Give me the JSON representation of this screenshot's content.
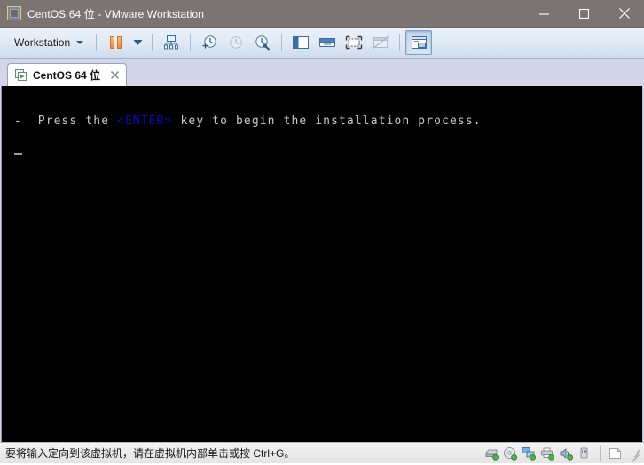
{
  "window": {
    "title": "CentOS 64 位 - VMware Workstation",
    "icon": "vmware-vm-icon",
    "controls": {
      "minimize": "minimize-icon",
      "maximize": "maximize-icon",
      "close": "close-icon"
    }
  },
  "toolbar": {
    "menu_label": "Workstation",
    "items": [
      {
        "name": "pause-vm-button",
        "icon": "pause-icon",
        "disabled": false
      },
      {
        "name": "power-dropdown-button",
        "icon": "chevron-down-icon",
        "disabled": false
      },
      {
        "name": "manage-vm-settings-button",
        "icon": "vm-settings-icon",
        "disabled": false
      },
      {
        "name": "take-snapshot-button",
        "icon": "snapshot-add-icon",
        "disabled": false
      },
      {
        "name": "revert-snapshot-button",
        "icon": "snapshot-revert-icon",
        "disabled": true
      },
      {
        "name": "snapshot-manager-button",
        "icon": "snapshot-manager-icon",
        "disabled": false
      },
      {
        "name": "show-library-button",
        "icon": "library-panel-icon",
        "disabled": false
      },
      {
        "name": "show-console-view-button",
        "icon": "console-view-icon",
        "disabled": false
      },
      {
        "name": "enter-full-screen-button",
        "icon": "full-screen-icon",
        "disabled": false
      },
      {
        "name": "unity-mode-button",
        "icon": "unity-mode-icon",
        "disabled": true
      },
      {
        "name": "show-thumbnail-bar-button",
        "icon": "thumbnail-bar-icon",
        "disabled": false,
        "pressed": true
      }
    ]
  },
  "tabs": [
    {
      "label": "CentOS 64 位",
      "icon": "vm-running-icon",
      "close_icon": "close-icon",
      "active": true
    }
  ],
  "console": {
    "line_prefix": "-  Press the ",
    "highlight": "<ENTER>",
    "line_suffix": " key to begin the installation process.",
    "cursor": "block-cursor",
    "background": "#000000",
    "foreground": "#c8c8c8",
    "highlight_color": "#0a0ab4"
  },
  "statusbar": {
    "message": "要将输入定向到该虚拟机，请在虚拟机内部单击或按 Ctrl+G。",
    "devices": [
      {
        "name": "hard-disk-icon",
        "label": "hard-disk"
      },
      {
        "name": "cd-dvd-icon",
        "label": "cd-dvd"
      },
      {
        "name": "network-adapter-icon",
        "label": "network-adapter"
      },
      {
        "name": "printer-icon",
        "label": "printer"
      },
      {
        "name": "sound-card-icon",
        "label": "sound-card"
      },
      {
        "name": "usb-device-icon",
        "label": "usb-device"
      }
    ],
    "message_area_icon": "message-log-icon",
    "resize_grip": "resize-grip"
  },
  "colors": {
    "titlebar": "#7a7472",
    "toolbar_top": "#eaf1f9",
    "toolbar_bottom": "#cfdcec",
    "tabstrip": "#d2d6e8",
    "accent_orange": "#e8892a",
    "badge_green": "#3ea03e"
  }
}
